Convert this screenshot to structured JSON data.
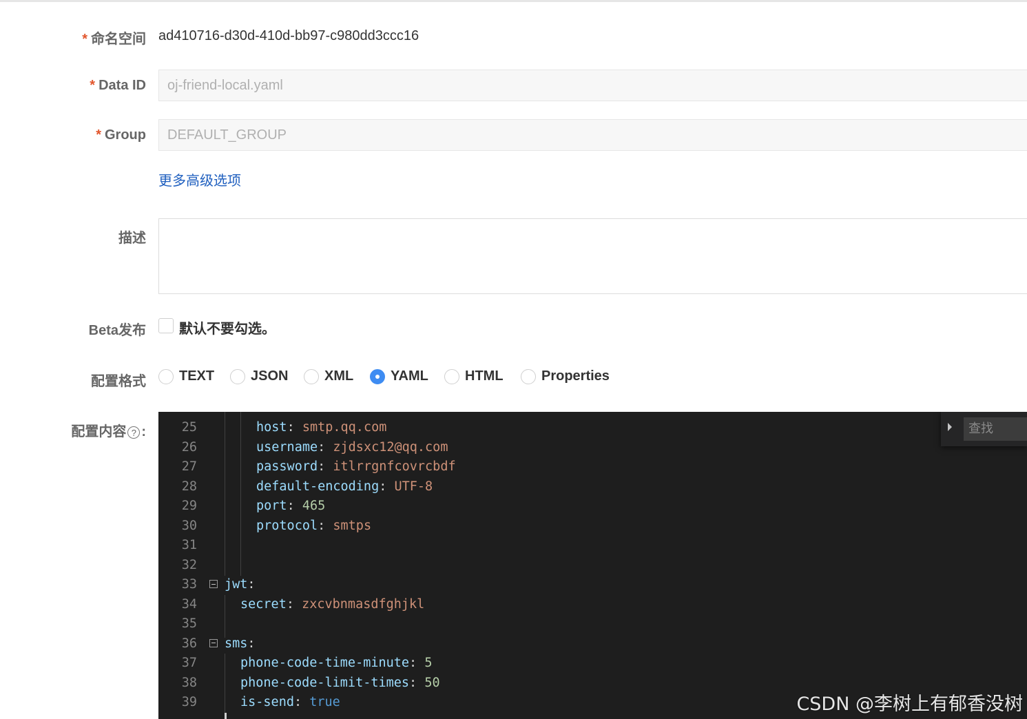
{
  "form": {
    "namespace": {
      "label": "命名空间",
      "value": "ad410716-d30d-410d-bb97-c980dd3ccc16"
    },
    "data_id": {
      "label": "Data ID",
      "value": "oj-friend-local.yaml"
    },
    "group": {
      "label": "Group",
      "value": "DEFAULT_GROUP"
    },
    "advanced_link": "更多高级选项",
    "description": {
      "label": "描述",
      "value": ""
    },
    "beta": {
      "label": "Beta发布",
      "checkbox_label": "默认不要勾选。",
      "checked": false
    },
    "format": {
      "label": "配置格式",
      "options": [
        "TEXT",
        "JSON",
        "XML",
        "YAML",
        "HTML",
        "Properties"
      ],
      "selected": "YAML"
    },
    "content": {
      "label": "配置内容",
      "help_icon": "?",
      "colon": ":"
    },
    "required_mark": "*"
  },
  "editor": {
    "find_placeholder": "查找",
    "lines": [
      {
        "n": "25",
        "key": "host",
        "value": "smtp.qq.com",
        "vtype": "s"
      },
      {
        "n": "26",
        "key": "username",
        "value": "zjdsxc12@qq.com",
        "vtype": "s"
      },
      {
        "n": "27",
        "key": "password",
        "value": "itlrrgnfcovrcbdf",
        "vtype": "s"
      },
      {
        "n": "28",
        "key": "default-encoding",
        "value": "UTF-8",
        "vtype": "s"
      },
      {
        "n": "29",
        "key": "port",
        "value": "465",
        "vtype": "n"
      },
      {
        "n": "30",
        "key": "protocol",
        "value": "smtps",
        "vtype": "s"
      },
      {
        "n": "31",
        "key": "",
        "value": "",
        "vtype": "s"
      },
      {
        "n": "32",
        "key": "",
        "value": "",
        "vtype": "s"
      },
      {
        "n": "33",
        "key": "jwt",
        "value": "",
        "vtype": "s",
        "fold": true
      },
      {
        "n": "34",
        "key": "secret",
        "value": "zxcvbnmasdfghjkl",
        "vtype": "s"
      },
      {
        "n": "35",
        "key": "",
        "value": "",
        "vtype": "s"
      },
      {
        "n": "36",
        "key": "sms",
        "value": "",
        "vtype": "s",
        "fold": true
      },
      {
        "n": "37",
        "key": "phone-code-time-minute",
        "value": "5",
        "vtype": "n"
      },
      {
        "n": "38",
        "key": "phone-code-limit-times",
        "value": "50",
        "vtype": "n"
      },
      {
        "n": "39",
        "key": "is-send",
        "value": "true",
        "vtype": "b"
      }
    ]
  },
  "watermark": "CSDN @李树上有郁香没树",
  "colors": {
    "accent": "#3e8cf2",
    "required": "#e2562d",
    "link": "#1f5fbf",
    "editor_bg": "#1e1e1e"
  }
}
